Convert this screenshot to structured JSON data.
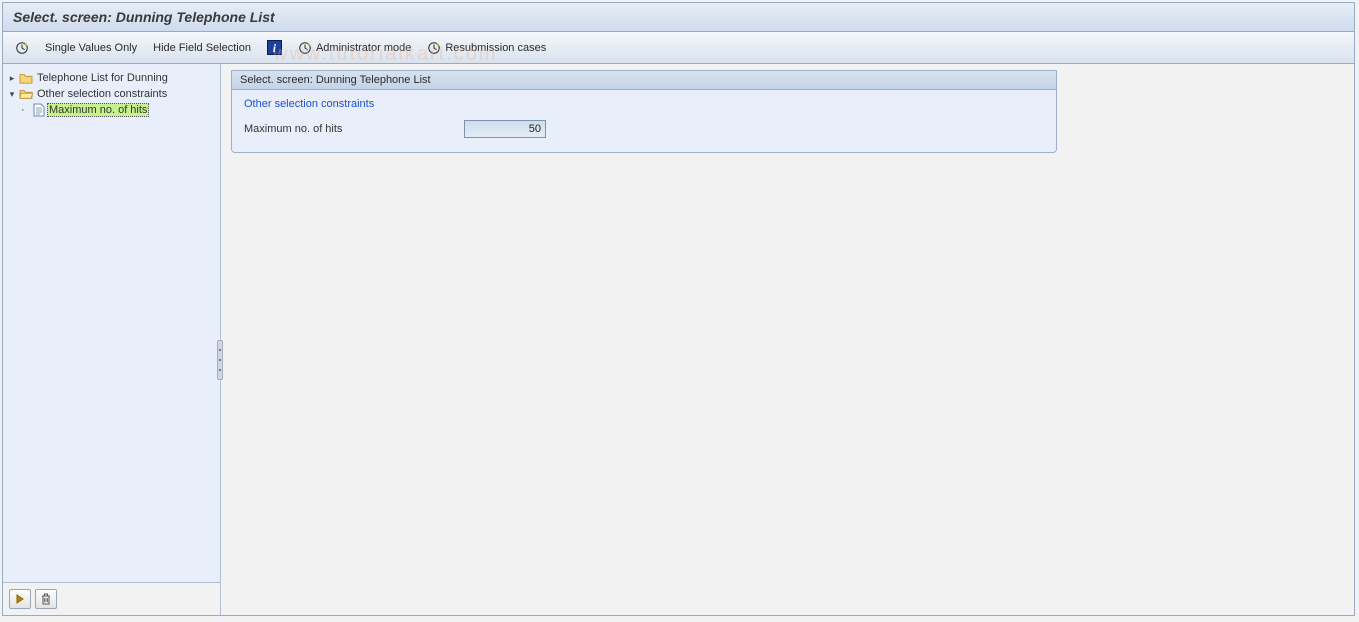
{
  "title": "Select. screen: Dunning Telephone List",
  "toolbar": {
    "execute_tooltip": "Execute",
    "single_values": "Single Values Only",
    "hide_field_selection": "Hide Field Selection",
    "info_tooltip": "Information",
    "admin_mode": "Administrator mode",
    "resubmission": "Resubmission cases"
  },
  "watermark": "www.tutorialkart.com",
  "tree": {
    "node1": {
      "label": "Telephone List for Dunning",
      "expanded": false
    },
    "node2": {
      "label": "Other selection constraints",
      "expanded": true
    },
    "node2_child1": {
      "label": "Maximum no. of hits",
      "selected": true
    }
  },
  "sidebar_footer": {
    "collapse_tooltip": "Expand/Collapse",
    "delete_tooltip": "Delete"
  },
  "panel": {
    "header": "Select. screen: Dunning Telephone List",
    "section_title": "Other selection constraints",
    "field_label": "Maximum no. of hits",
    "field_value": "50"
  }
}
